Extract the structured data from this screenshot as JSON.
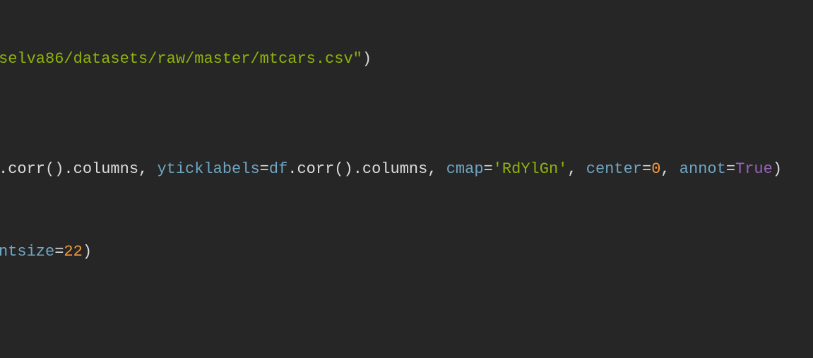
{
  "editor": {
    "lines": [
      {
        "tokens": [
          {
            "text": "selva86/datasets/raw/master/mtcars.csv\"",
            "type": "string"
          },
          {
            "text": ")",
            "type": "plain"
          }
        ]
      },
      {
        "tokens": [
          {
            "text": ".corr().columns, ",
            "type": "plain"
          },
          {
            "text": "yticklabels",
            "type": "param"
          },
          {
            "text": "=",
            "type": "plain"
          },
          {
            "text": "df",
            "type": "param"
          },
          {
            "text": ".corr().columns, ",
            "type": "plain"
          },
          {
            "text": "cmap",
            "type": "param"
          },
          {
            "text": "=",
            "type": "plain"
          },
          {
            "text": "'RdYlGn'",
            "type": "string"
          },
          {
            "text": ", ",
            "type": "plain"
          },
          {
            "text": "center",
            "type": "param"
          },
          {
            "text": "=",
            "type": "plain"
          },
          {
            "text": "0",
            "type": "number"
          },
          {
            "text": ", ",
            "type": "plain"
          },
          {
            "text": "annot",
            "type": "param"
          },
          {
            "text": "=",
            "type": "plain"
          },
          {
            "text": "True",
            "type": "keyword"
          },
          {
            "text": ")",
            "type": "plain"
          }
        ]
      },
      {
        "tokens": [
          {
            "text": "ntsize",
            "type": "param"
          },
          {
            "text": "=",
            "type": "plain"
          },
          {
            "text": "22",
            "type": "number"
          },
          {
            "text": ")",
            "type": "plain"
          }
        ]
      }
    ],
    "colors": {
      "background": "#262626",
      "string": "#8fb30a",
      "param": "#6fa6c4",
      "number": "#f39b3c",
      "keyword": "#9a63bd",
      "plain": "#dcdcdc"
    }
  }
}
